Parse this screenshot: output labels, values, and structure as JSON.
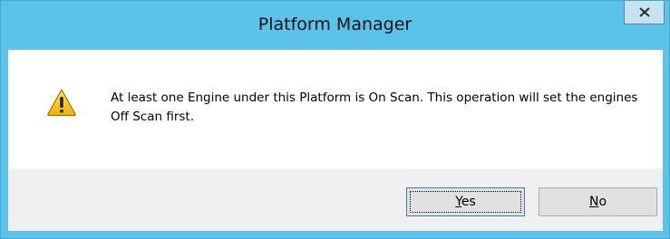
{
  "dialog": {
    "title": "Platform Manager",
    "message": "At least one Engine under this Platform is On Scan. This operation will set the engines Off Scan first.",
    "icon": "warning-icon",
    "buttons": {
      "yes": {
        "mnemonic": "Y",
        "rest": "es"
      },
      "no": {
        "mnemonic": "N",
        "rest": "o"
      }
    }
  },
  "colors": {
    "titlebar": "#5bc3ea",
    "content_bg": "#ffffff",
    "footer_bg": "#f0f0f0",
    "warning_fill": "#f5c400"
  }
}
